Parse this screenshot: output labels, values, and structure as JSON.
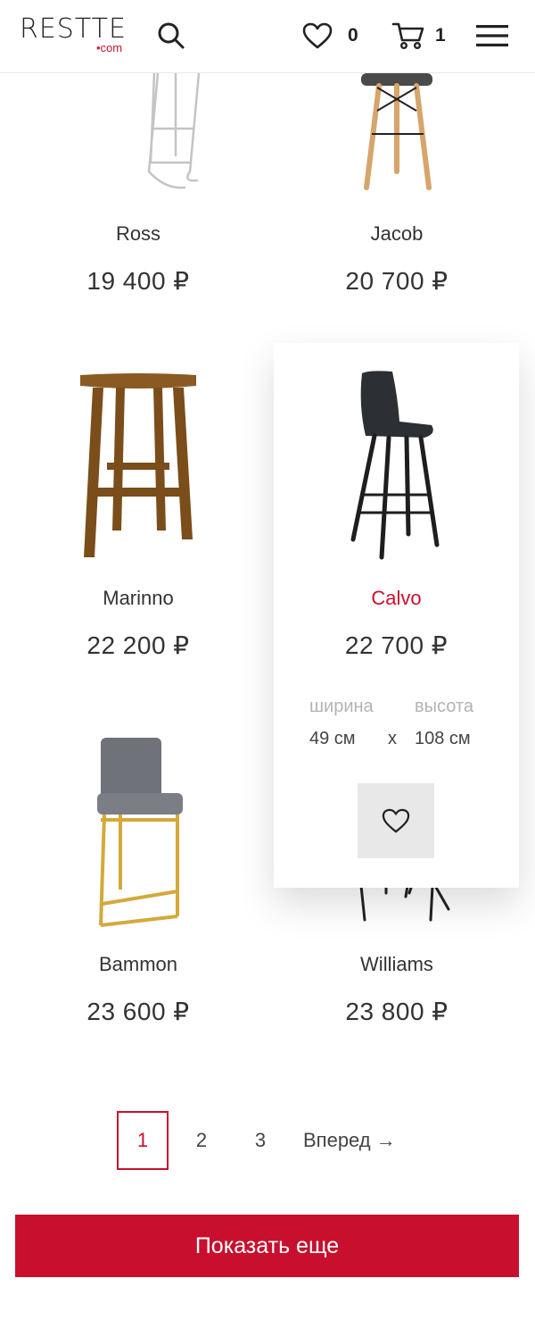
{
  "header": {
    "logo_main": "RESTTE",
    "logo_sub": "•com",
    "favorites_count": "0",
    "cart_count": "1"
  },
  "products": [
    {
      "name": "Ross",
      "price": "19 400 ₽"
    },
    {
      "name": "Jacob",
      "price": "20 700 ₽"
    },
    {
      "name": "Marinno",
      "price": "22 200 ₽"
    },
    {
      "name": "Calvo",
      "price": "22 700 ₽",
      "width_label": "ширина",
      "height_label": "высота",
      "width_value": "49 см",
      "height_value": "108 см",
      "times": "x"
    },
    {
      "name": "Bammon",
      "price": "23 600 ₽"
    },
    {
      "name": "Williams",
      "price": "23 800 ₽"
    }
  ],
  "pagination": {
    "pages": [
      "1",
      "2",
      "3"
    ],
    "next": "Вперед →",
    "active": "1"
  },
  "show_more_label": "Показать еще",
  "colors": {
    "accent": "#c8102e",
    "text": "#333333",
    "muted": "#b3b3b3"
  }
}
